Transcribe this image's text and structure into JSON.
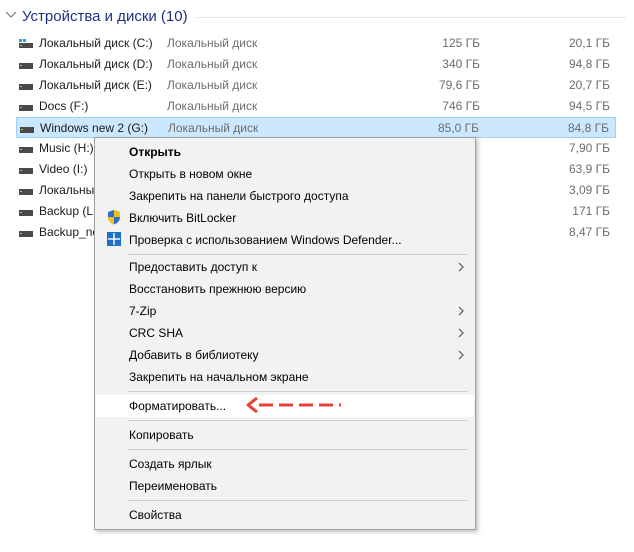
{
  "group": {
    "title": "Устройства и диски (10)"
  },
  "drives": [
    {
      "name": "Локальный диск (C:)",
      "type": "Локальный диск",
      "total": "125 ГБ",
      "free": "20,1 ГБ"
    },
    {
      "name": "Локальный диск (D:)",
      "type": "Локальный диск",
      "total": "340 ГБ",
      "free": "94,8 ГБ"
    },
    {
      "name": "Локальный диск (E:)",
      "type": "Локальный диск",
      "total": "79,6 ГБ",
      "free": "20,7 ГБ"
    },
    {
      "name": "Docs (F:)",
      "type": "Локальный диск",
      "total": "746 ГБ",
      "free": "94,5 ГБ"
    },
    {
      "name": "Windows new 2 (G:)",
      "type": "Локальный диск",
      "total": "85,0 ГБ",
      "free": "84,8 ГБ"
    },
    {
      "name": "Music (H:)",
      "type": "",
      "total": "",
      "free": "7,90 ГБ"
    },
    {
      "name": "Video (I:)",
      "type": "",
      "total": "",
      "free": "63,9 ГБ"
    },
    {
      "name": "Локальны",
      "type": "",
      "total": "",
      "free": "3,09 ГБ"
    },
    {
      "name": "Backup (L:",
      "type": "",
      "total": "",
      "free": "171 ГБ"
    },
    {
      "name": "Backup_ne",
      "type": "",
      "total": "",
      "free": "8,47 ГБ"
    }
  ],
  "menu": {
    "open": "Открыть",
    "open_new_window": "Открыть в новом окне",
    "pin_quick_access": "Закрепить на панели быстрого доступа",
    "bitlocker": "Включить BitLocker",
    "defender": "Проверка с использованием Windows Defender...",
    "give_access": "Предоставить доступ к",
    "restore_prev": "Восстановить прежнюю версию",
    "zip": "7-Zip",
    "crc": "CRC SHA",
    "add_library": "Добавить в библиотеку",
    "pin_start": "Закрепить на начальном экране",
    "format": "Форматировать...",
    "copy": "Копировать",
    "create_shortcut": "Создать ярлык",
    "rename": "Переименовать",
    "properties": "Свойства"
  },
  "colors": {
    "accent": "#1e3287",
    "selection": "#cce8ff",
    "arrow": "#e8413c"
  }
}
